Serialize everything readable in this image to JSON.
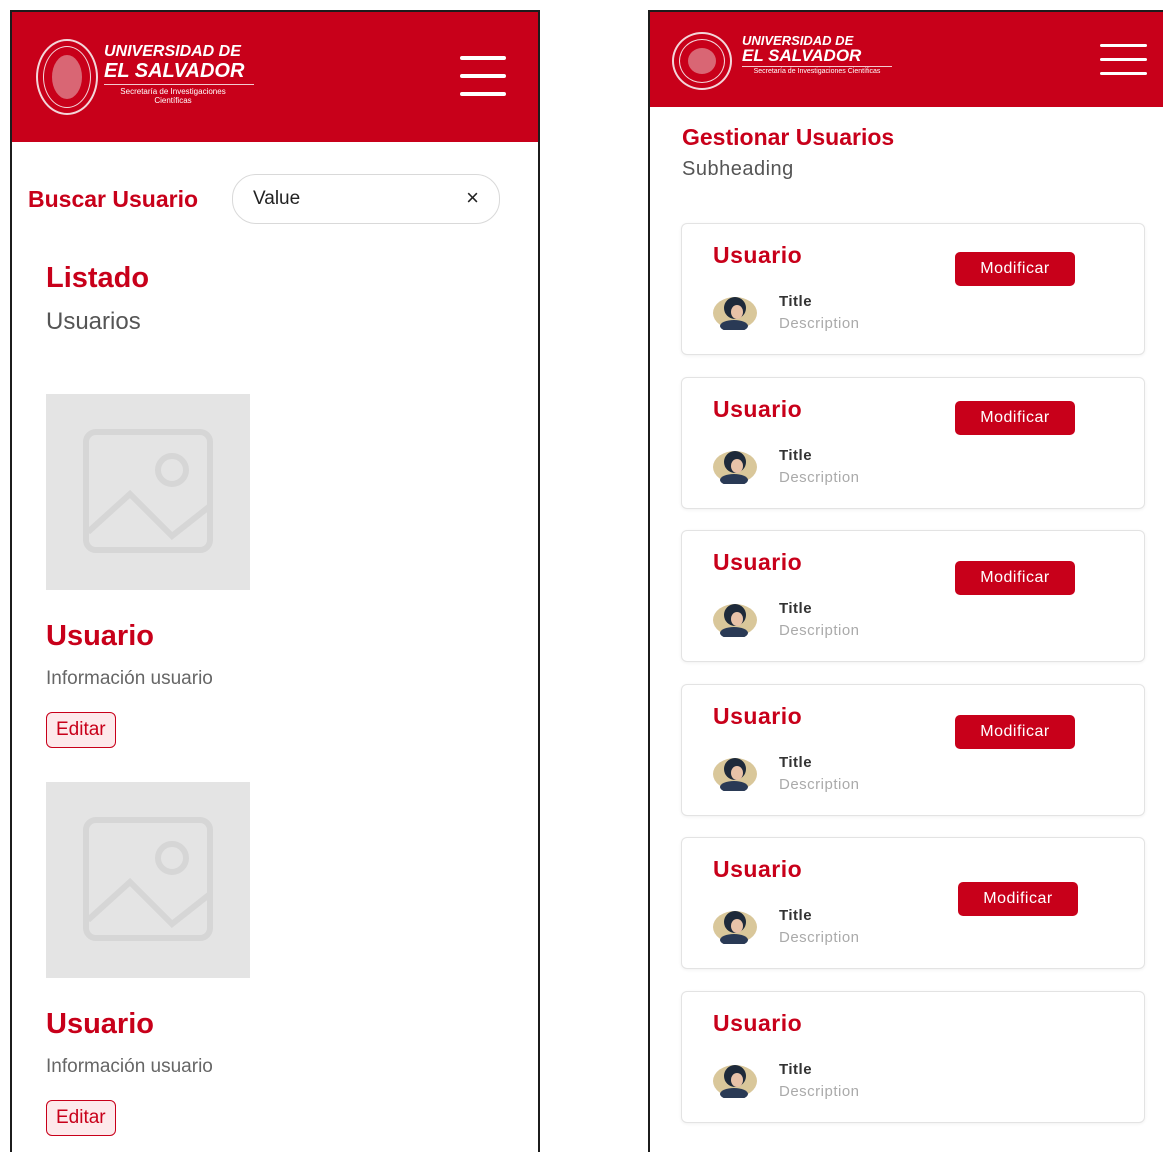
{
  "brand": {
    "line1": "UNIVERSIDAD DE",
    "line2": "EL SALVADOR",
    "subtitle": "Secretaría de Investigaciones Científicas",
    "color": "#c8001a"
  },
  "left_screen": {
    "search_label": "Buscar Usuario",
    "search_value": "Value",
    "clear_icon": "×",
    "list_title": "Listado",
    "list_subtitle": "Usuarios",
    "cards": [
      {
        "name": "Usuario",
        "info": "Información usuario",
        "button": "Editar"
      },
      {
        "name": "Usuario",
        "info": "Información usuario",
        "button": "Editar"
      }
    ]
  },
  "right_screen": {
    "title": "Gestionar Usuarios",
    "subtitle": "Subheading",
    "users": [
      {
        "name": "Usuario",
        "button": "Modificar",
        "title": "Title",
        "description": "Description"
      },
      {
        "name": "Usuario",
        "button": "Modificar",
        "title": "Title",
        "description": "Description"
      },
      {
        "name": "Usuario",
        "button": "Modificar",
        "title": "Title",
        "description": "Description"
      },
      {
        "name": "Usuario",
        "button": "Modificar",
        "title": "Title",
        "description": "Description"
      },
      {
        "name": "Usuario",
        "button": "Modificar",
        "title": "Title",
        "description": "Description"
      },
      {
        "name": "Usuario",
        "title": "Title",
        "description": "Description"
      }
    ]
  }
}
